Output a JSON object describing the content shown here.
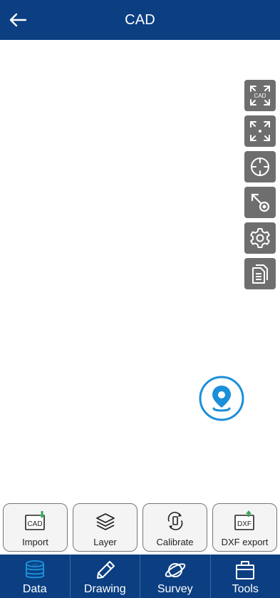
{
  "header": {
    "title": "CAD"
  },
  "right_tools": [
    {
      "icon": "cad-extent-icon",
      "label": "CAD"
    },
    {
      "icon": "full-extent-icon"
    },
    {
      "icon": "crosshair-icon"
    },
    {
      "icon": "goto-point-icon"
    },
    {
      "icon": "settings-icon"
    },
    {
      "icon": "document-list-icon"
    }
  ],
  "subbar": {
    "items": [
      {
        "label": "Import",
        "icon": "cad-import-icon",
        "icon_text": "CAD"
      },
      {
        "label": "Layer",
        "icon": "layers-icon"
      },
      {
        "label": "Calibrate",
        "icon": "calibrate-icon"
      },
      {
        "label": "DXF export",
        "icon": "dxf-export-icon",
        "icon_text": "DXF"
      }
    ]
  },
  "bottom_nav": {
    "items": [
      {
        "label": "Data",
        "icon": "database-icon",
        "active": true
      },
      {
        "label": "Drawing",
        "icon": "pen-icon",
        "active": false
      },
      {
        "label": "Survey",
        "icon": "survey-icon",
        "active": false
      },
      {
        "label": "Tools",
        "icon": "toolbox-icon",
        "active": false
      }
    ]
  },
  "colors": {
    "primary": "#0b3f82",
    "tool_gray": "#6e6e6e",
    "locate_blue": "#1b8fd8",
    "accent_green": "#3aa657"
  }
}
